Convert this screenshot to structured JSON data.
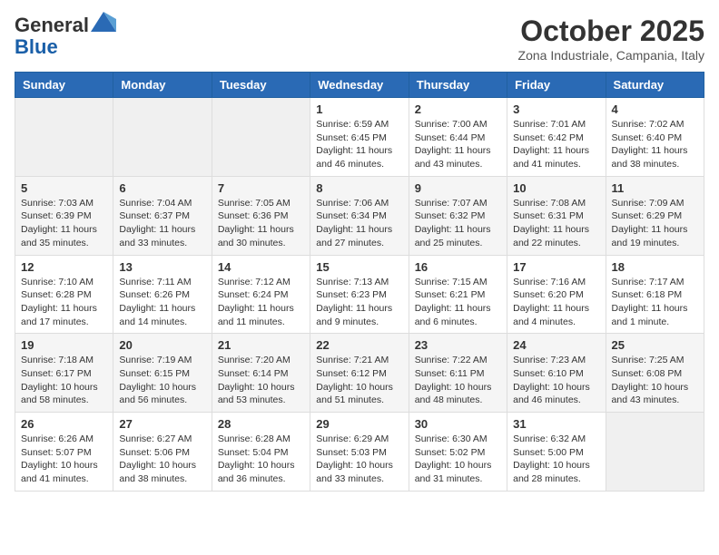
{
  "header": {
    "logo_general": "General",
    "logo_blue": "Blue",
    "month_title": "October 2025",
    "location": "Zona Industriale, Campania, Italy"
  },
  "weekdays": [
    "Sunday",
    "Monday",
    "Tuesday",
    "Wednesday",
    "Thursday",
    "Friday",
    "Saturday"
  ],
  "weeks": [
    [
      {
        "day": "",
        "info": ""
      },
      {
        "day": "",
        "info": ""
      },
      {
        "day": "",
        "info": ""
      },
      {
        "day": "1",
        "info": "Sunrise: 6:59 AM\nSunset: 6:45 PM\nDaylight: 11 hours and 46 minutes."
      },
      {
        "day": "2",
        "info": "Sunrise: 7:00 AM\nSunset: 6:44 PM\nDaylight: 11 hours and 43 minutes."
      },
      {
        "day": "3",
        "info": "Sunrise: 7:01 AM\nSunset: 6:42 PM\nDaylight: 11 hours and 41 minutes."
      },
      {
        "day": "4",
        "info": "Sunrise: 7:02 AM\nSunset: 6:40 PM\nDaylight: 11 hours and 38 minutes."
      }
    ],
    [
      {
        "day": "5",
        "info": "Sunrise: 7:03 AM\nSunset: 6:39 PM\nDaylight: 11 hours and 35 minutes."
      },
      {
        "day": "6",
        "info": "Sunrise: 7:04 AM\nSunset: 6:37 PM\nDaylight: 11 hours and 33 minutes."
      },
      {
        "day": "7",
        "info": "Sunrise: 7:05 AM\nSunset: 6:36 PM\nDaylight: 11 hours and 30 minutes."
      },
      {
        "day": "8",
        "info": "Sunrise: 7:06 AM\nSunset: 6:34 PM\nDaylight: 11 hours and 27 minutes."
      },
      {
        "day": "9",
        "info": "Sunrise: 7:07 AM\nSunset: 6:32 PM\nDaylight: 11 hours and 25 minutes."
      },
      {
        "day": "10",
        "info": "Sunrise: 7:08 AM\nSunset: 6:31 PM\nDaylight: 11 hours and 22 minutes."
      },
      {
        "day": "11",
        "info": "Sunrise: 7:09 AM\nSunset: 6:29 PM\nDaylight: 11 hours and 19 minutes."
      }
    ],
    [
      {
        "day": "12",
        "info": "Sunrise: 7:10 AM\nSunset: 6:28 PM\nDaylight: 11 hours and 17 minutes."
      },
      {
        "day": "13",
        "info": "Sunrise: 7:11 AM\nSunset: 6:26 PM\nDaylight: 11 hours and 14 minutes."
      },
      {
        "day": "14",
        "info": "Sunrise: 7:12 AM\nSunset: 6:24 PM\nDaylight: 11 hours and 11 minutes."
      },
      {
        "day": "15",
        "info": "Sunrise: 7:13 AM\nSunset: 6:23 PM\nDaylight: 11 hours and 9 minutes."
      },
      {
        "day": "16",
        "info": "Sunrise: 7:15 AM\nSunset: 6:21 PM\nDaylight: 11 hours and 6 minutes."
      },
      {
        "day": "17",
        "info": "Sunrise: 7:16 AM\nSunset: 6:20 PM\nDaylight: 11 hours and 4 minutes."
      },
      {
        "day": "18",
        "info": "Sunrise: 7:17 AM\nSunset: 6:18 PM\nDaylight: 11 hours and 1 minute."
      }
    ],
    [
      {
        "day": "19",
        "info": "Sunrise: 7:18 AM\nSunset: 6:17 PM\nDaylight: 10 hours and 58 minutes."
      },
      {
        "day": "20",
        "info": "Sunrise: 7:19 AM\nSunset: 6:15 PM\nDaylight: 10 hours and 56 minutes."
      },
      {
        "day": "21",
        "info": "Sunrise: 7:20 AM\nSunset: 6:14 PM\nDaylight: 10 hours and 53 minutes."
      },
      {
        "day": "22",
        "info": "Sunrise: 7:21 AM\nSunset: 6:12 PM\nDaylight: 10 hours and 51 minutes."
      },
      {
        "day": "23",
        "info": "Sunrise: 7:22 AM\nSunset: 6:11 PM\nDaylight: 10 hours and 48 minutes."
      },
      {
        "day": "24",
        "info": "Sunrise: 7:23 AM\nSunset: 6:10 PM\nDaylight: 10 hours and 46 minutes."
      },
      {
        "day": "25",
        "info": "Sunrise: 7:25 AM\nSunset: 6:08 PM\nDaylight: 10 hours and 43 minutes."
      }
    ],
    [
      {
        "day": "26",
        "info": "Sunrise: 6:26 AM\nSunset: 5:07 PM\nDaylight: 10 hours and 41 minutes."
      },
      {
        "day": "27",
        "info": "Sunrise: 6:27 AM\nSunset: 5:06 PM\nDaylight: 10 hours and 38 minutes."
      },
      {
        "day": "28",
        "info": "Sunrise: 6:28 AM\nSunset: 5:04 PM\nDaylight: 10 hours and 36 minutes."
      },
      {
        "day": "29",
        "info": "Sunrise: 6:29 AM\nSunset: 5:03 PM\nDaylight: 10 hours and 33 minutes."
      },
      {
        "day": "30",
        "info": "Sunrise: 6:30 AM\nSunset: 5:02 PM\nDaylight: 10 hours and 31 minutes."
      },
      {
        "day": "31",
        "info": "Sunrise: 6:32 AM\nSunset: 5:00 PM\nDaylight: 10 hours and 28 minutes."
      },
      {
        "day": "",
        "info": ""
      }
    ]
  ]
}
